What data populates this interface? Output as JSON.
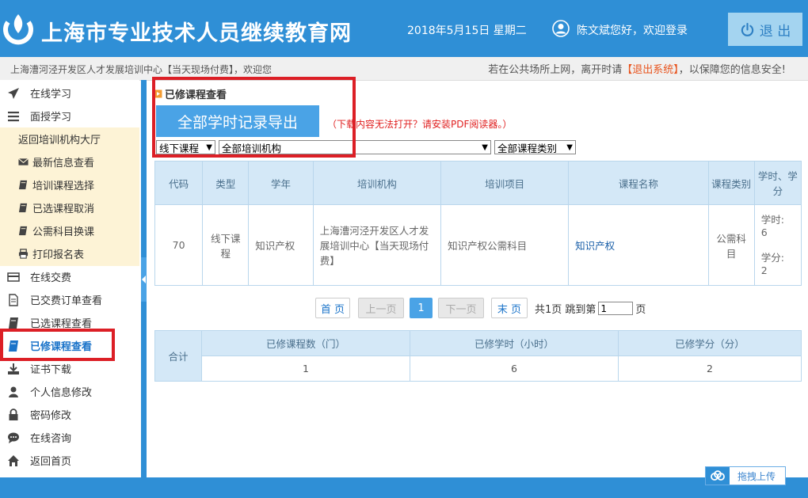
{
  "header": {
    "site_title": "上海市专业技术人员继续教育网",
    "date": "2018年5月15日 星期二",
    "welcome": "陈文斌您好，欢迎登录",
    "logout_label": "退 出"
  },
  "infobar": {
    "org_welcome": "上海漕河泾开发区人才发展培训中心【当天现场付费】，欢迎您",
    "notice_prefix": "若在公共场所上网，离开时请",
    "notice_link": "【退出系统】",
    "notice_suffix": "，以保障您的信息安全!"
  },
  "sidebar": {
    "items": [
      {
        "label": "在线学习",
        "icon": "paper-plane-icon"
      },
      {
        "label": "面授学习",
        "icon": "list-icon"
      },
      {
        "label": "在线交费",
        "icon": "card-icon"
      },
      {
        "label": "已交费订单查看",
        "icon": "document-icon"
      },
      {
        "label": "已选课程查看",
        "icon": "book-icon"
      },
      {
        "label": "已修课程查看",
        "icon": "book-icon"
      },
      {
        "label": "证书下载",
        "icon": "download-icon"
      },
      {
        "label": "个人信息修改",
        "icon": "user-icon"
      },
      {
        "label": "密码修改",
        "icon": "lock-icon"
      },
      {
        "label": "在线咨询",
        "icon": "chat-icon"
      },
      {
        "label": "返回首页",
        "icon": "home-icon"
      }
    ],
    "subitems": [
      {
        "label": "返回培训机构大厅",
        "icon": ""
      },
      {
        "label": "最新信息查看",
        "icon": "envelope-icon"
      },
      {
        "label": "培训课程选择",
        "icon": "book-icon"
      },
      {
        "label": "已选课程取消",
        "icon": "book-icon"
      },
      {
        "label": "公需科目换课",
        "icon": "book-icon"
      },
      {
        "label": "打印报名表",
        "icon": "printer-icon"
      }
    ]
  },
  "main": {
    "section_title": "已修课程查看",
    "export_label": "全部学时记录导出",
    "pdf_note": "（下载内容无法打开？请安装PDF阅读器。）",
    "filters": {
      "course_mode": "线下课程",
      "institution": "全部培训机构",
      "category": "全部课程类别"
    },
    "table": {
      "headers": [
        "代码",
        "类型",
        "学年",
        "培训机构",
        "培训项目",
        "课程名称",
        "课程类别",
        "学时、学分"
      ],
      "rows": [
        {
          "code": "70",
          "type": "线下课程",
          "year": "知识产权",
          "institution": "上海漕河泾开发区人才发展培训中心【当天现场付费】",
          "project": "知识产权公需科目",
          "course": "知识产权",
          "category": "公需科目",
          "hours_label": "学时:",
          "hours": "6",
          "credits_label": "学分:",
          "credits": "2"
        }
      ]
    },
    "pagination": {
      "first": "首 页",
      "prev": "上一页",
      "current": "1",
      "next": "下一页",
      "last": "末 页",
      "info": "共1页 跳到第",
      "input_value": "1",
      "unit": "页"
    },
    "summary": {
      "total_label": "合计",
      "headers": [
        "已修课程数（门）",
        "已修学时（小时）",
        "已修学分（分）"
      ],
      "values": [
        "1",
        "6",
        "2"
      ]
    }
  },
  "upload_widget": {
    "label": "拖拽上传"
  },
  "colors": {
    "primary": "#2f8fd6",
    "accent": "#4aa3e6",
    "highlight": "#dc1f26",
    "submenu_bg": "#fdf3d6"
  }
}
